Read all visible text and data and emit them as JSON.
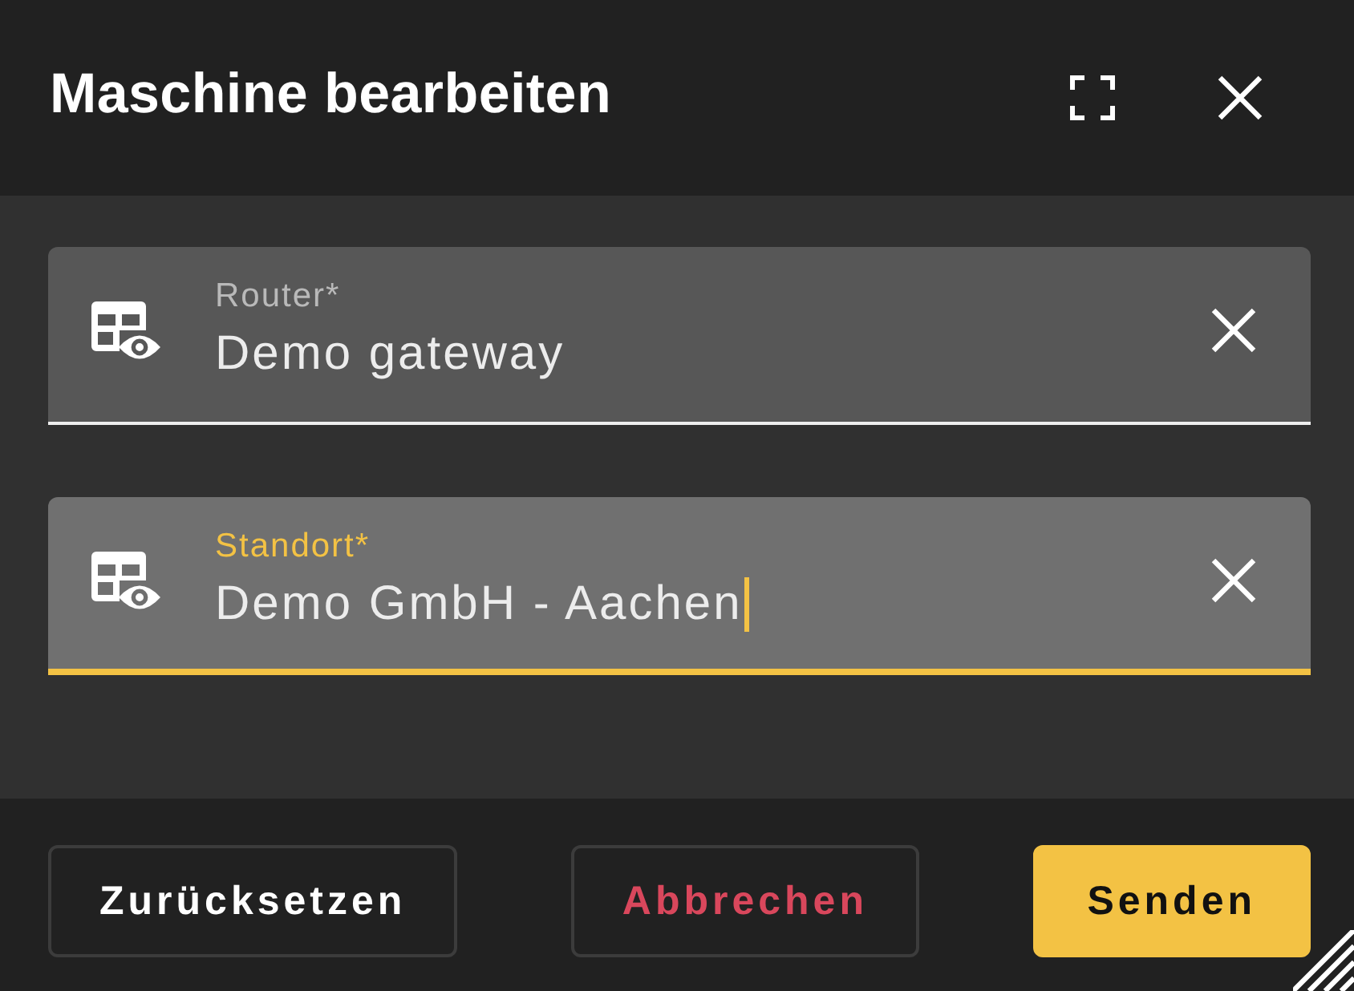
{
  "dialog": {
    "title": "Maschine bearbeiten"
  },
  "fields": [
    {
      "label": "Router*",
      "value": "Demo gateway",
      "focused": false
    },
    {
      "label": "Standort*",
      "value": "Demo GmbH - Aachen",
      "focused": true
    }
  ],
  "buttons": [
    {
      "label": "Zurücksetzen",
      "kind": "outlined"
    },
    {
      "label": "Abbrechen",
      "kind": "danger"
    },
    {
      "label": "Senden",
      "kind": "primary"
    }
  ]
}
